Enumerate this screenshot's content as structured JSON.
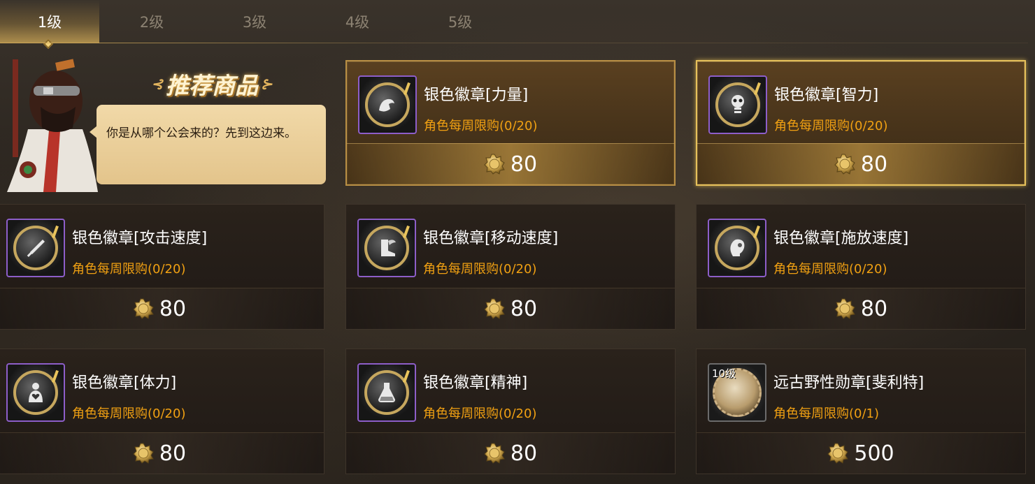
{
  "tabs": [
    {
      "label": "1级",
      "active": true
    },
    {
      "label": "2级",
      "active": false
    },
    {
      "label": "3级",
      "active": false
    },
    {
      "label": "4级",
      "active": false
    },
    {
      "label": "5级",
      "active": false
    }
  ],
  "recommended": {
    "title": "推荐商品",
    "npc_dialog": "你是从哪个公会来的？先到这边来。"
  },
  "currency_icon": "gold-coin-icon",
  "items": [
    {
      "name": "银色徽章[力量]",
      "limit": "角色每周限购(0/20)",
      "price": "80",
      "icon": "strength-arm-icon"
    },
    {
      "name": "银色徽章[智力]",
      "limit": "角色每周限购(0/20)",
      "price": "80",
      "icon": "intelligence-skull-icon"
    },
    {
      "name": "银色徽章[攻击速度]",
      "limit": "角色每周限购(0/20)",
      "price": "80",
      "icon": "sword-icon"
    },
    {
      "name": "银色徽章[移动速度]",
      "limit": "角色每周限购(0/20)",
      "price": "80",
      "icon": "winged-boot-icon"
    },
    {
      "name": "银色徽章[施放速度]",
      "limit": "角色每周限购(0/20)",
      "price": "80",
      "icon": "head-profile-icon"
    },
    {
      "name": "银色徽章[体力]",
      "limit": "角色每周限购(0/20)",
      "price": "80",
      "icon": "heart-body-icon"
    },
    {
      "name": "银色徽章[精神]",
      "limit": "角色每周限购(0/20)",
      "price": "80",
      "icon": "potion-flask-icon"
    },
    {
      "name": "远古野性勋章[斐利特]",
      "limit": "角色每周限购(0/1)",
      "price": "500",
      "icon": "ancient-medal-icon",
      "level_badge": "10级"
    }
  ],
  "colors": {
    "accent": "#e7c15a",
    "limit_text": "#f0a012",
    "rare_border": "#8d5ec9"
  }
}
